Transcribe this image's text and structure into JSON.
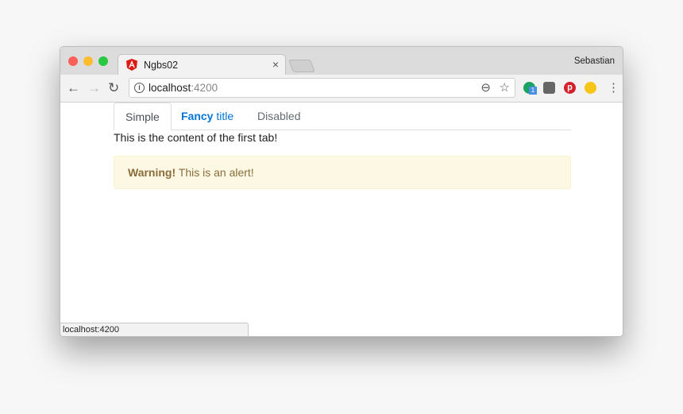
{
  "browser": {
    "tab_title": "Ngbs02",
    "tab_close": "×",
    "profile_name": "Sebastian",
    "url_host": "localhost",
    "url_port": ":4200",
    "extension_badge": "1",
    "status_text": "localhost:4200"
  },
  "page": {
    "tabs": [
      {
        "label": "Simple",
        "state": "active"
      },
      {
        "label_bold": "Fancy",
        "label_rest": " title"
      },
      {
        "label": "Disabled",
        "state": "disabled"
      }
    ],
    "tab_content": "This is the content of the first tab!",
    "alert": {
      "strong": "Warning!",
      "text": " This is an alert!"
    }
  },
  "colors": {
    "link": "#0275d8",
    "alert_bg": "#fcf8e3",
    "alert_text": "#8a6d3b"
  }
}
